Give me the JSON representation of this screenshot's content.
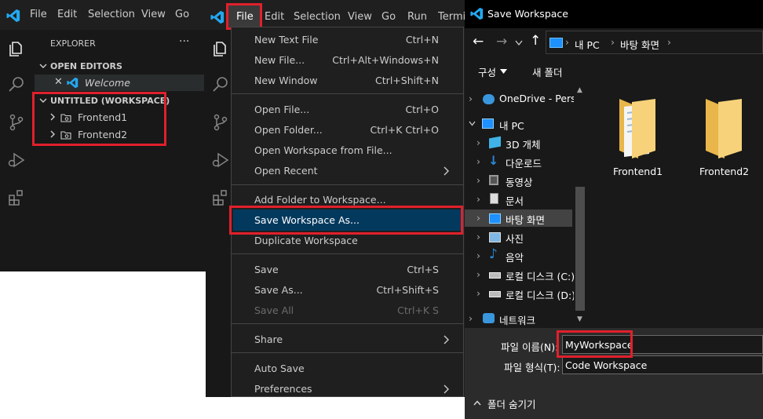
{
  "vscode": {
    "menubar": [
      "File",
      "Edit",
      "Selection",
      "View",
      "Go",
      "Run",
      "Terminal"
    ],
    "explorer": {
      "title": "EXPLORER",
      "more": "···",
      "open_editors": "OPEN EDITORS",
      "welcome_tab": "Welcome",
      "workspace_title": "UNTITLED (WORKSPACE)",
      "folders": [
        "Frontend1",
        "Frontend2"
      ]
    },
    "file_menu": [
      {
        "label": "New Text File",
        "shortcut": "Ctrl+N"
      },
      {
        "label": "New File...",
        "shortcut": "Ctrl+Alt+Windows+N"
      },
      {
        "label": "New Window",
        "shortcut": "Ctrl+Shift+N"
      },
      {
        "label": "Open File...",
        "shortcut": "Ctrl+O"
      },
      {
        "label": "Open Folder...",
        "shortcut": "Ctrl+K Ctrl+O"
      },
      {
        "label": "Open Workspace from File...",
        "shortcut": ""
      },
      {
        "label": "Open Recent",
        "shortcut": ""
      },
      {
        "label": "Add Folder to Workspace...",
        "shortcut": ""
      },
      {
        "label": "Save Workspace As...",
        "shortcut": ""
      },
      {
        "label": "Duplicate Workspace",
        "shortcut": ""
      },
      {
        "label": "Save",
        "shortcut": "Ctrl+S"
      },
      {
        "label": "Save As...",
        "shortcut": "Ctrl+Shift+S"
      },
      {
        "label": "Save All",
        "shortcut": "Ctrl+K S"
      },
      {
        "label": "Share",
        "shortcut": ""
      },
      {
        "label": "Auto Save",
        "shortcut": ""
      },
      {
        "label": "Preferences",
        "shortcut": ""
      }
    ]
  },
  "dialog": {
    "title": "Save Workspace",
    "breadcrumb": [
      "내 PC",
      "바탕 화면"
    ],
    "toolbar": {
      "organize": "구성",
      "new_folder": "새 폴더"
    },
    "tree": [
      {
        "label": "OneDrive - Person"
      },
      {
        "label": "내 PC"
      },
      {
        "label": "3D 개체"
      },
      {
        "label": "다운로드"
      },
      {
        "label": "동영상"
      },
      {
        "label": "문서"
      },
      {
        "label": "바탕 화면"
      },
      {
        "label": "사진"
      },
      {
        "label": "음악"
      },
      {
        "label": "로컬 디스크 (C:)"
      },
      {
        "label": "로컬 디스크 (D:)"
      },
      {
        "label": "네트워크"
      }
    ],
    "files": [
      "Frontend1",
      "Frontend2"
    ],
    "filename_label": "파일 이름(N):",
    "filename_value": "MyWorkspace",
    "filetype_label": "파일 형식(T):",
    "filetype_value": "Code Workspace",
    "hide_folders": "폴더 숨기기"
  },
  "colors": {
    "accent": "#0078d4",
    "highlight": "#e0202c",
    "vscode_blue": "#23a8f2"
  }
}
